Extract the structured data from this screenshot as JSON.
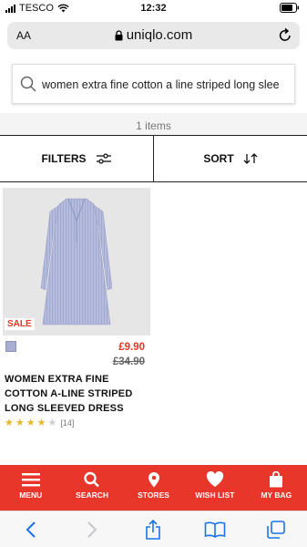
{
  "status_bar": {
    "carrier": "TESCO",
    "time": "12:32"
  },
  "browser": {
    "aa_label": "AA",
    "domain": "uniqlo.com"
  },
  "search": {
    "value": "women extra fine cotton a line striped long slee"
  },
  "results": {
    "count_text": "1 items"
  },
  "controls": {
    "filters_label": "FILTERS",
    "sort_label": "SORT"
  },
  "product": {
    "sale_badge": "SALE",
    "price": "£9.90",
    "original_price": "£34.90",
    "name": "WOMEN EXTRA FINE COTTON A-LINE STRIPED LONG SLEEVED DRESS",
    "rating_count": "[14]",
    "rating": 4,
    "rating_max": 5,
    "swatch_color": "#a8aed0"
  },
  "bottom_nav": [
    {
      "label": "MENU",
      "icon": "menu-icon"
    },
    {
      "label": "SEARCH",
      "icon": "search-icon"
    },
    {
      "label": "STORES",
      "icon": "location-pin-icon"
    },
    {
      "label": "WISH LIST",
      "icon": "heart-icon"
    },
    {
      "label": "MY BAG",
      "icon": "shopping-bag-icon"
    }
  ],
  "colors": {
    "brand_red": "#e8362b",
    "sale_red": "#ee3322",
    "star_gold": "#e6b82e"
  }
}
